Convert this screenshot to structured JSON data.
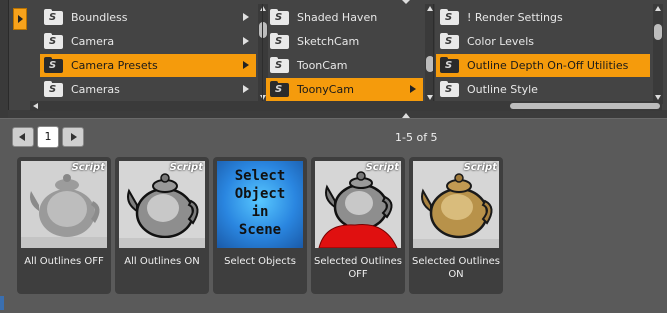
{
  "browser": {
    "columns": [
      {
        "items": [
          {
            "label": "Boundless",
            "selected": false,
            "has_children": true
          },
          {
            "label": "Camera",
            "selected": false,
            "has_children": true
          },
          {
            "label": "Camera Presets",
            "selected": true,
            "has_children": true
          },
          {
            "label": "Cameras",
            "selected": false,
            "has_children": true
          }
        ]
      },
      {
        "items": [
          {
            "label": "Shaded Haven",
            "selected": false,
            "has_children": false
          },
          {
            "label": "SketchCam",
            "selected": false,
            "has_children": false
          },
          {
            "label": "ToonCam",
            "selected": false,
            "has_children": false
          },
          {
            "label": "ToonyCam",
            "selected": true,
            "has_children": true
          }
        ]
      },
      {
        "items": [
          {
            "label": "! Render Settings",
            "selected": false,
            "has_children": false
          },
          {
            "label": "Color Levels",
            "selected": false,
            "has_children": false
          },
          {
            "label": "Outline Depth On-Off Utilities",
            "selected": true,
            "has_children": false
          },
          {
            "label": "Outline Style",
            "selected": false,
            "has_children": false
          }
        ]
      }
    ],
    "folder_badge": "S",
    "accent_color": "#f59b0c"
  },
  "pager": {
    "current_page": "1",
    "count_text": "1-5 of 5"
  },
  "tiles": [
    {
      "label_line1": "All Outlines OFF",
      "label_line2": "",
      "badge": "Script",
      "thumb": "teapot-gray-outline"
    },
    {
      "label_line1": "All Outlines ON",
      "label_line2": "",
      "badge": "Script",
      "thumb": "teapot-gray-ink"
    },
    {
      "label_line1": "Select Objects",
      "label_line2": "",
      "badge": "",
      "thumb": "select-object-text",
      "thumb_text": [
        "Select",
        "Object",
        "in",
        "Scene"
      ]
    },
    {
      "label_line1": "Selected Outlines",
      "label_line2": "OFF",
      "badge": "Script",
      "thumb": "teapot-red-cloth"
    },
    {
      "label_line1": "Selected Outlines",
      "label_line2": "ON",
      "badge": "Script",
      "thumb": "teapot-gold"
    }
  ]
}
